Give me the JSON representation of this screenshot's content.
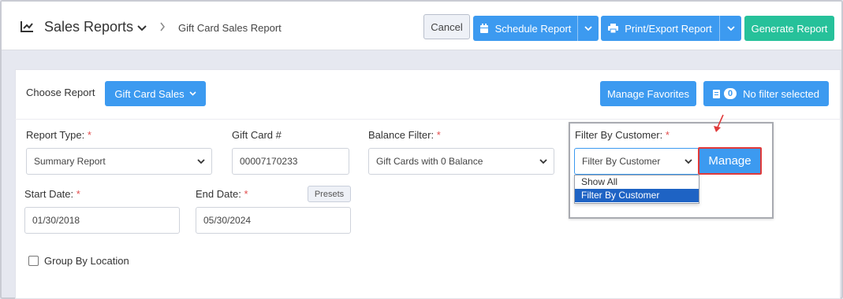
{
  "header": {
    "title": "Sales Reports",
    "breadcrumb": "Gift Card Sales Report",
    "buttons": {
      "cancel": "Cancel",
      "schedule": "Schedule Report",
      "print_export": "Print/Export Report",
      "generate": "Generate Report"
    }
  },
  "toolbar": {
    "choose_report_label": "Choose Report",
    "selected_report": "Gift Card Sales",
    "manage_favorites": "Manage Favorites",
    "filter_count": "0",
    "filter_status": "No filter selected"
  },
  "form": {
    "report_type": {
      "label": "Report Type:",
      "required": "*",
      "value": "Summary Report"
    },
    "gift_card": {
      "label": "Gift Card #",
      "value": "00007170233"
    },
    "balance_filter": {
      "label": "Balance Filter:",
      "required": "*",
      "value": "Gift Cards with 0 Balance"
    },
    "filter_by_customer": {
      "label": "Filter By Customer:",
      "required": "*",
      "value": "Filter By Customer",
      "options": [
        "Show All",
        "Filter By Customer"
      ],
      "manage_button": "Manage"
    },
    "start_date": {
      "label": "Start Date:",
      "required": "*",
      "value": "01/30/2018"
    },
    "end_date": {
      "label": "End Date:",
      "required": "*",
      "value": "05/30/2024"
    },
    "presets_button": "Presets",
    "group_by_location": {
      "label": "Group By Location",
      "checked": false
    }
  },
  "colors": {
    "primary": "#3c9af0",
    "success": "#26c19a",
    "required": "#e24d4d",
    "highlight": "#e03a3a",
    "selected_option": "#1e63c4"
  }
}
